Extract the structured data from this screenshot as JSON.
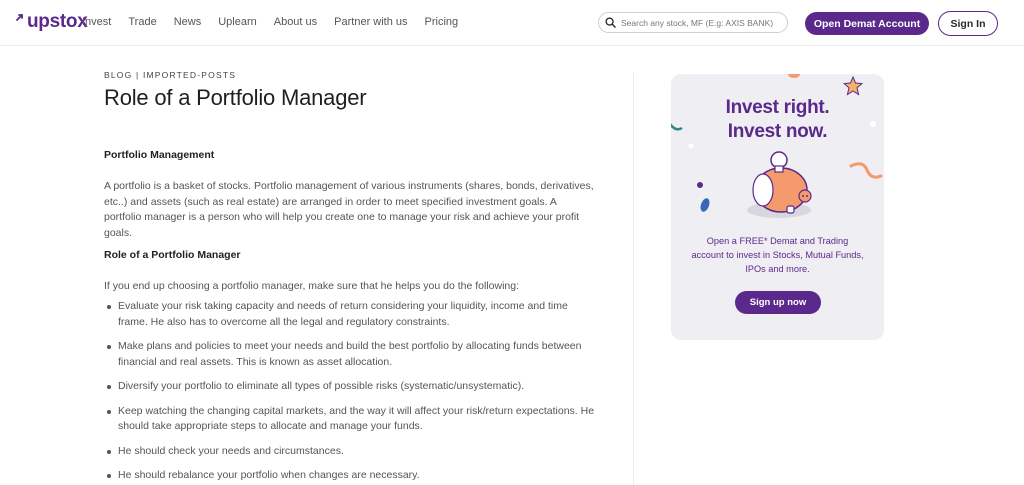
{
  "header": {
    "logo": "upstox",
    "nav": [
      "Invest",
      "Trade",
      "News",
      "Uplearn",
      "About us",
      "Partner with us",
      "Pricing"
    ],
    "search_placeholder": "Search any stock, MF (E.g: AXIS BANK)",
    "demat_button": "Open Demat Account",
    "signin_button": "Sign In"
  },
  "article": {
    "breadcrumb": "BLOG | IMPORTED-POSTS",
    "title": "Role of a Portfolio Manager",
    "section1_heading": "Portfolio Management",
    "section1_body": "A portfolio is a basket of stocks. Portfolio management of various instruments (shares, bonds, derivatives, etc..) and assets (such as real estate) are arranged in order to meet specified investment goals. A portfolio manager is a person who will help you create one to manage your risk and achieve your profit goals.",
    "section2_heading": "Role of a Portfolio Manager",
    "section2_intro": "If you end up choosing a portfolio manager, make sure that he helps you do the following:",
    "bullets": [
      "Evaluate your risk taking capacity and needs of return considering your liquidity, income and time frame. He also has to overcome all the legal and regulatory constraints.",
      "Make plans and policies to meet your needs and build the best portfolio by allocating funds between financial and real assets. This is known as asset allocation.",
      "Diversify your portfolio to eliminate all types of possible risks (systematic/unsystematic).",
      "Keep watching the changing capital markets, and the way it will affect your risk/return expectations. He should take appropriate steps to allocate and manage your funds.",
      "He should check your needs and circumstances.",
      "He should rebalance your portfolio when changes are necessary."
    ]
  },
  "promo": {
    "line1": "Invest right.",
    "line2": "Invest now.",
    "body": "Open a FREE* Demat and Trading account to invest in Stocks, Mutual Funds, IPOs and more.",
    "button": "Sign up now"
  },
  "colors": {
    "brand": "#5a298b",
    "piggy": "#f49a6c",
    "accent_teal": "#2d8a8a"
  }
}
